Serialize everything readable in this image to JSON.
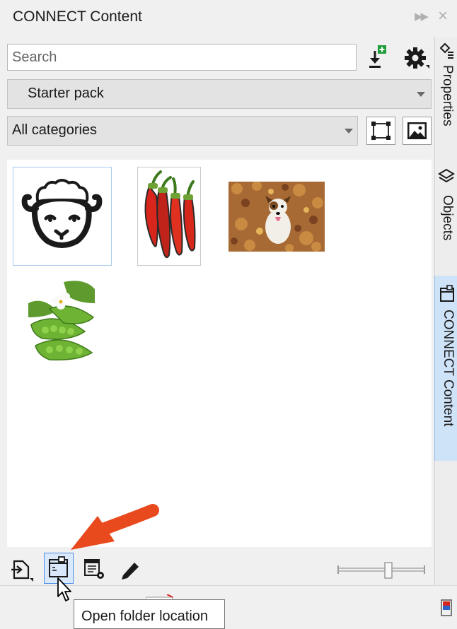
{
  "panel": {
    "title": "CONNECT Content"
  },
  "search": {
    "placeholder": "Search",
    "value": ""
  },
  "toolbar_top": {
    "import_icon": "download-plus-icon",
    "settings_icon": "gear-icon"
  },
  "pack_dropdown": {
    "selected": "Starter pack"
  },
  "category_dropdown": {
    "selected": "All categories"
  },
  "view_buttons": [
    "vector-view-icon",
    "bitmap-view-icon"
  ],
  "thumbnails": [
    {
      "name": "sheep-clipart",
      "kind": "vector",
      "selected": true
    },
    {
      "name": "chili-peppers",
      "kind": "vector",
      "selected": false
    },
    {
      "name": "dog-in-leaves",
      "kind": "photo",
      "selected": false
    },
    {
      "name": "pea-pods",
      "kind": "photo",
      "selected": false
    }
  ],
  "bottom_toolbar": {
    "buttons": [
      "add-to-tray-icon",
      "open-folder-icon",
      "properties-icon",
      "edit-icon"
    ],
    "active": "open-folder-icon"
  },
  "docker_tabs": [
    {
      "label": "Properties",
      "active": false
    },
    {
      "label": "Objects",
      "active": false
    },
    {
      "label": "CONNECT Content",
      "active": true
    }
  ],
  "tooltip": {
    "text": "Open folder location"
  },
  "colors": {
    "accent": "#4b8ee6",
    "active_tab": "#cfe3f8",
    "arrow": "#e8491d"
  }
}
